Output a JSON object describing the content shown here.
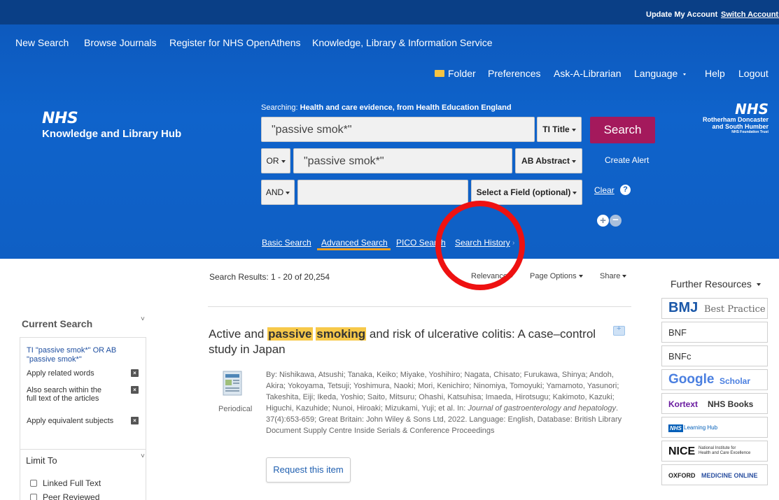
{
  "topbar": {
    "update_account": "Update My Account",
    "switch_accounts": "Switch Accounts"
  },
  "main_nav": [
    "New Search",
    "Browse Journals",
    "Register for NHS OpenAthens",
    "Knowledge, Library & Information Service"
  ],
  "util_nav": {
    "folder": "Folder",
    "preferences": "Preferences",
    "ask": "Ask-A-Librarian",
    "language": "Language",
    "help": "Help",
    "logout": "Logout"
  },
  "logo": {
    "badge": "NHS",
    "subtitle": "Knowledge and Library Hub"
  },
  "trust_logo": {
    "badge": "NHS",
    "name_line1": "Rotherham Doncaster",
    "name_line2": "and South Humber",
    "name_line3": "NHS Foundation Trust"
  },
  "searching": {
    "label": "Searching:",
    "value": "Health and care evidence, from Health Education England"
  },
  "search_rows": [
    {
      "operator": "",
      "value": "\"passive smok*\"",
      "field": "TI Title"
    },
    {
      "operator": "OR",
      "value": "\"passive smok*\"",
      "field": "AB Abstract"
    },
    {
      "operator": "AND",
      "value": "",
      "field": "Select a Field (optional)"
    }
  ],
  "search_button": "Search",
  "create_alert": "Create Alert",
  "clear": "Clear",
  "help_glyph": "?",
  "plus_glyph": "+",
  "minus_glyph": "−",
  "search_modes": [
    "Basic Search",
    "Advanced Search",
    "PICO Search",
    "Search History"
  ],
  "results_bar": {
    "count_text": "Search Results: 1 - 20 of 20,254",
    "relevance": "Relevance",
    "page_options": "Page Options",
    "share": "Share"
  },
  "further_resources": {
    "heading": "Further Resources",
    "items": [
      {
        "label": "BMJ Best Practice",
        "mark": "BMJ",
        "text": "Best Practice"
      },
      {
        "label": "BNF"
      },
      {
        "label": "BNFc"
      },
      {
        "label": "Google Scholar",
        "mark": "Google",
        "text": "Scholar"
      },
      {
        "label": "Kortext NHS Books",
        "mark": "Kortext",
        "text": "NHS Books"
      },
      {
        "label": "NHS Learning Hub",
        "mark": "NHS",
        "text": "Learning Hub"
      },
      {
        "label": "NICE National Institute for Health and Care Excellence",
        "mark": "NICE",
        "line1": "National Institute for",
        "line2": "Health and Care Excellence"
      },
      {
        "label": "OXFORD MEDICINE ONLINE",
        "mark": "OXFORD",
        "text": "MEDICINE ONLINE"
      }
    ]
  },
  "current_search": {
    "heading": "Current Search",
    "term": "TI \"passive smok*\" OR AB \"passive smok*\"",
    "options": [
      "Apply related words",
      "Also search within the full text of the articles",
      "Apply equivalent subjects"
    ],
    "remove_glyph": "×"
  },
  "limit_to": {
    "heading": "Limit To",
    "options": [
      "Linked Full Text",
      "Peer Reviewed"
    ]
  },
  "result": {
    "title_pre": "Active and",
    "hl1": "passive",
    "hl2": "smoking",
    "title_post": "and risk of ulcerative colitis: A case–control study in Japan",
    "type": "Periodical",
    "meta_authors": "By: Nishikawa, Atsushi; Tanaka, Keiko; Miyake, Yoshihiro; Nagata, Chisato; Furukawa, Shinya; Andoh, Akira; Yokoyama, Tetsuji; Yoshimura, Naoki; Mori, Kenichiro; Ninomiya, Tomoyuki; Yamamoto, Yasunori; Takeshita, Eiji; Ikeda, Yoshio; Saito, Mitsuru; Ohashi, Katsuhisa; Imaeda, Hirotsugu; Kakimoto, Kazuki; Higuchi, Kazuhide; Nunoi, Hiroaki; Mizukami, Yuji; et al. In:",
    "meta_journal": "Journal of gastroenterology and hepatology",
    "meta_rest": ". 37(4):653-659; Great Britain: John Wiley & Sons Ltd, 2022. Language: English, Database: British Library Document Supply Centre Inside Serials & Conference Proceedings",
    "request_button": "Request this item"
  },
  "colors": {
    "header_blue": "#0f5fc4",
    "topbar": "#0a3f86",
    "search_button": "#a4195c",
    "highlight": "#f7c94a",
    "annotation_circle": "#ee1111"
  }
}
